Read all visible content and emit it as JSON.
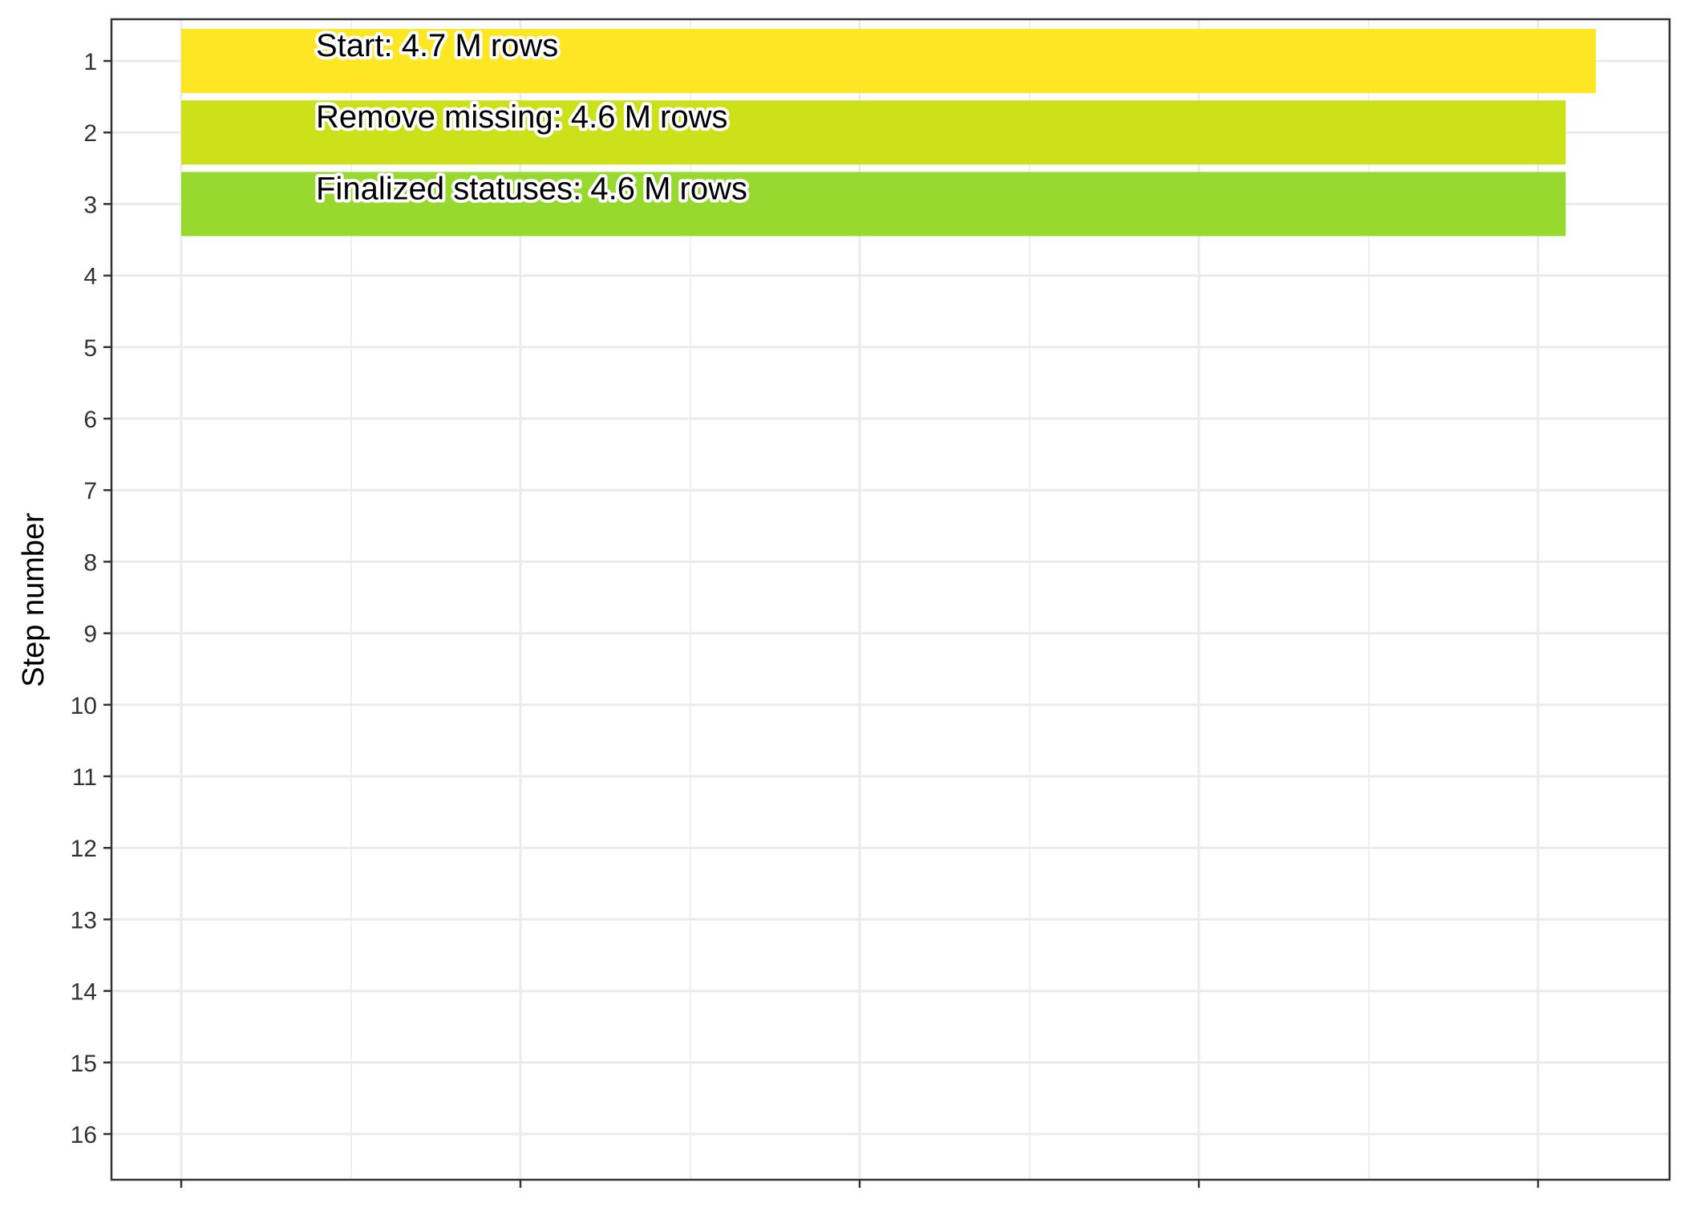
{
  "chart_data": {
    "type": "bar",
    "orientation": "horizontal",
    "ylabel": "Step number",
    "xlabel": "",
    "y_ticks": [
      "1",
      "2",
      "3",
      "4",
      "5",
      "6",
      "7",
      "8",
      "9",
      "10",
      "11",
      "12",
      "13",
      "14",
      "15",
      "16"
    ],
    "ylim": [
      0.5,
      16.5
    ],
    "x_tick_labels_visible": false,
    "grid": true,
    "series": [
      {
        "steps": [
          1,
          2,
          3
        ],
        "labels": [
          "Start:  4.7 M rows",
          "Remove missing:  4.6 M rows",
          "Finalized statuses:  4.6 M rows"
        ],
        "values": [
          4.7,
          4.6,
          4.6
        ],
        "colors": [
          "#fde725",
          "#cce11a",
          "#97d92e"
        ]
      }
    ]
  }
}
